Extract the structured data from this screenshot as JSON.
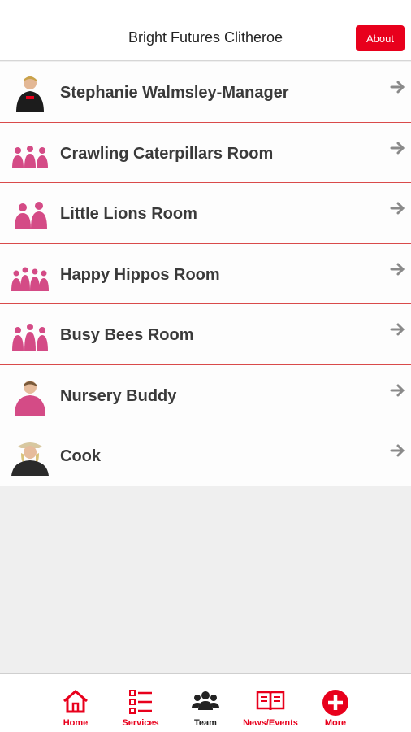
{
  "header": {
    "title": "Bright Futures Clitheroe",
    "about_label": "About"
  },
  "list": {
    "items": [
      {
        "label": "Stephanie Walmsley-Manager",
        "icon": "person-photo"
      },
      {
        "label": "Crawling Caterpillars Room",
        "icon": "group-photo"
      },
      {
        "label": "Little Lions Room",
        "icon": "group-photo"
      },
      {
        "label": "Happy Hippos Room",
        "icon": "group-photo"
      },
      {
        "label": "Busy Bees Room",
        "icon": "group-photo"
      },
      {
        "label": "Nursery Buddy",
        "icon": "person-photo"
      },
      {
        "label": "Cook",
        "icon": "person-photo"
      }
    ]
  },
  "tabbar": {
    "tabs": [
      {
        "label": "Home",
        "icon": "home-icon"
      },
      {
        "label": "Services",
        "icon": "list-icon"
      },
      {
        "label": "Team",
        "icon": "team-icon"
      },
      {
        "label": "News/Events",
        "icon": "book-icon"
      },
      {
        "label": "More",
        "icon": "plus-circle-icon"
      }
    ]
  },
  "colors": {
    "accent": "#e8001c",
    "divider": "#d94a4a",
    "background": "#efefef"
  }
}
